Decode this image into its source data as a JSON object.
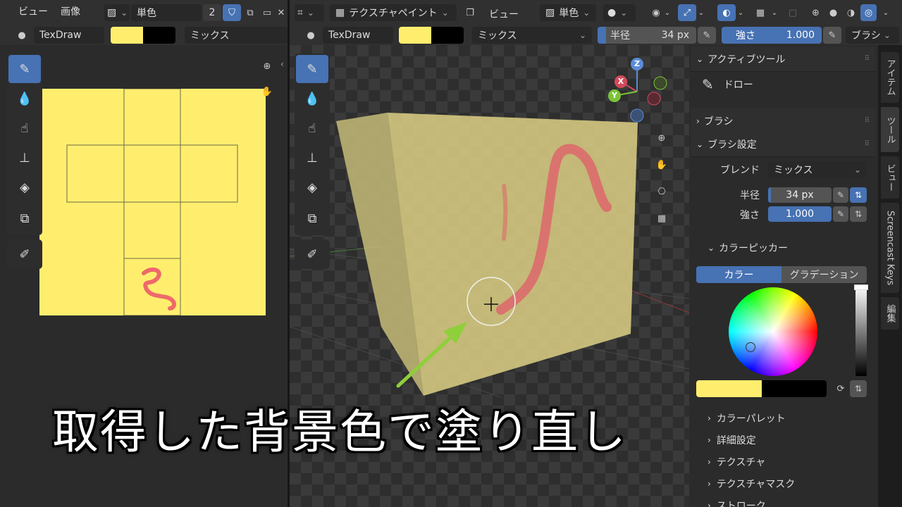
{
  "left_editor": {
    "menu": [
      "ビュー",
      "画像"
    ],
    "image_mode": "単色",
    "users": "2",
    "brush_name": "TexDraw",
    "blend": "ミックス"
  },
  "viewport": {
    "mode": "テクスチャペイント",
    "view_menu": "ビュー",
    "shading": "単色",
    "brush_name": "TexDraw",
    "blend": "ミックス",
    "radius_label": "半径",
    "radius_value": "34 px",
    "strength_label": "強さ",
    "strength_value": "1.000",
    "brush_menu": "ブラシ",
    "gizmo": {
      "x": "X",
      "y": "Y",
      "z": "Z"
    }
  },
  "sidebar": {
    "active_tool_header": "アクティブツール",
    "active_tool_name": "ドロー",
    "brush_header": "ブラシ",
    "brush_settings_header": "ブラシ設定",
    "blend_label": "ブレンド",
    "blend_value": "ミックス",
    "radius_label": "半径",
    "radius_value": "34 px",
    "strength_label": "強さ",
    "strength_value": "1.000",
    "color_picker_header": "カラーピッカー",
    "color_tab": "カラー",
    "gradient_tab": "グラデーション",
    "subsections": [
      "カラーパレット",
      "詳細設定",
      "テクスチャ",
      "テクスチャマスク",
      "ストローク"
    ],
    "tabs": [
      "アイテム",
      "ツール",
      "ビュー",
      "Screencast Keys",
      "編集"
    ]
  },
  "colors": {
    "primary": "#ffee6e",
    "secondary": "#000000",
    "accent": "#4772b3",
    "stroke": "#e86a6a"
  },
  "caption": "取得した背景色で塗り直し"
}
